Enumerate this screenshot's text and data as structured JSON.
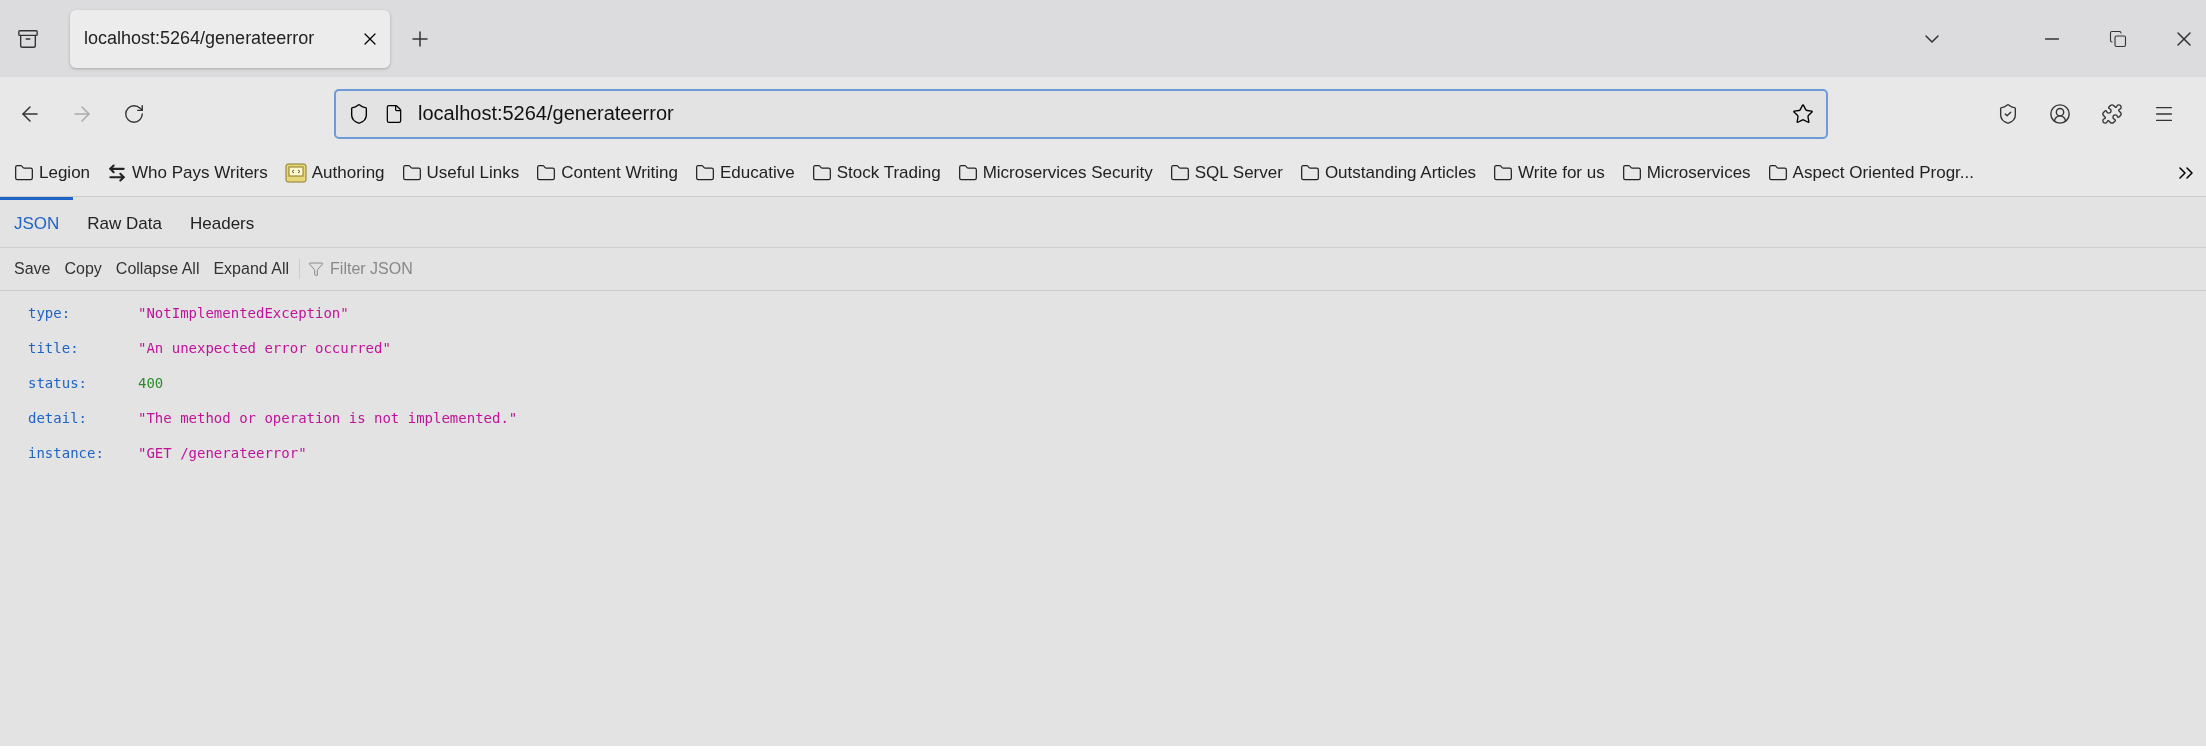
{
  "browser_tab": {
    "title": "localhost:5264/generateerror",
    "selected": true
  },
  "address_bar": {
    "value": "localhost:5264/generateerror"
  },
  "bookmarks": [
    {
      "kind": "folder",
      "label": "Legion"
    },
    {
      "kind": "swap",
      "label": "Who Pays Writers"
    },
    {
      "kind": "code",
      "label": "Authoring"
    },
    {
      "kind": "folder",
      "label": "Useful Links"
    },
    {
      "kind": "folder",
      "label": "Content Writing"
    },
    {
      "kind": "folder",
      "label": "Educative"
    },
    {
      "kind": "folder",
      "label": "Stock Trading"
    },
    {
      "kind": "folder",
      "label": "Microservices Security"
    },
    {
      "kind": "folder",
      "label": "SQL Server"
    },
    {
      "kind": "folder",
      "label": "Outstanding Articles"
    },
    {
      "kind": "folder",
      "label": "Write for us"
    },
    {
      "kind": "folder",
      "label": "Microservices"
    },
    {
      "kind": "folder",
      "label": "Aspect Oriented Progr..."
    }
  ],
  "viewer_tabs": [
    {
      "label": "JSON",
      "selected": true
    },
    {
      "label": "Raw Data",
      "selected": false
    },
    {
      "label": "Headers",
      "selected": false
    }
  ],
  "viewer_toolbar": {
    "buttons": [
      "Save",
      "Copy",
      "Collapse All",
      "Expand All"
    ],
    "filter_placeholder": "Filter JSON"
  },
  "json_rows": [
    {
      "key": "type:",
      "kind": "string",
      "value": "\"NotImplementedException\""
    },
    {
      "key": "title:",
      "kind": "string",
      "value": "\"An unexpected error occurred\""
    },
    {
      "key": "status:",
      "kind": "number",
      "value": "400"
    },
    {
      "key": "detail:",
      "kind": "string",
      "value": "\"The method or operation is not implemented.\""
    },
    {
      "key": "instance:",
      "kind": "string",
      "value": "\"GET /generateerror\""
    }
  ]
}
